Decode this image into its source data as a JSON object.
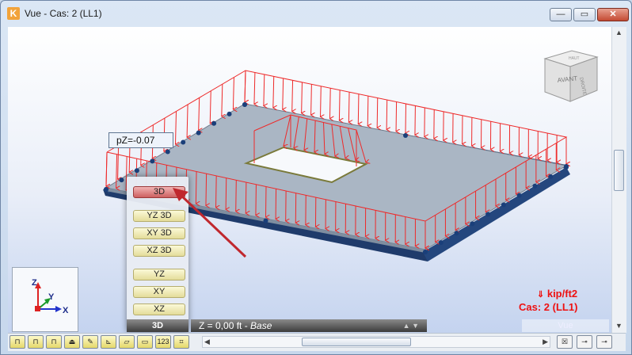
{
  "window": {
    "title": "Vue - Cas: 2 (LL1)",
    "app_icon_glyph": "K",
    "controls": {
      "minimize": "—",
      "maximize": "▭",
      "close": "✕"
    }
  },
  "view": {
    "pz_label": "pZ=-0.07",
    "navcube": {
      "front": "AVANT",
      "right": "DROITE",
      "top": "HAUT"
    },
    "axes": {
      "x": "X",
      "y": "Y",
      "z": "Z"
    },
    "legend": {
      "unit": "kip/ft2",
      "case": "Cas: 2 (LL1)"
    },
    "colors": {
      "load_red": "#ee2a2a",
      "slab": "#aab6c4",
      "support": "#1f3b6b",
      "accent_red": "#c0282e"
    }
  },
  "view_menu": {
    "items": [
      {
        "label": "3D",
        "selected": true
      },
      {
        "label": "YZ 3D"
      },
      {
        "label": "XY 3D"
      },
      {
        "label": "XZ 3D"
      },
      {
        "label": "YZ"
      },
      {
        "label": "XY"
      },
      {
        "label": "XZ"
      }
    ],
    "footer": "3D"
  },
  "z_bar": {
    "prefix": "Z = 0,00 ft - ",
    "level": "Base"
  },
  "vue_button": "Vue",
  "toolbar": {
    "buttons": [
      "⊓",
      "⊓",
      "⊓",
      "⏏",
      "✎",
      "⊾",
      "▱",
      "▭",
      "123",
      "⌗"
    ],
    "right_icons": [
      "☒",
      "⊸",
      "⊸"
    ]
  }
}
